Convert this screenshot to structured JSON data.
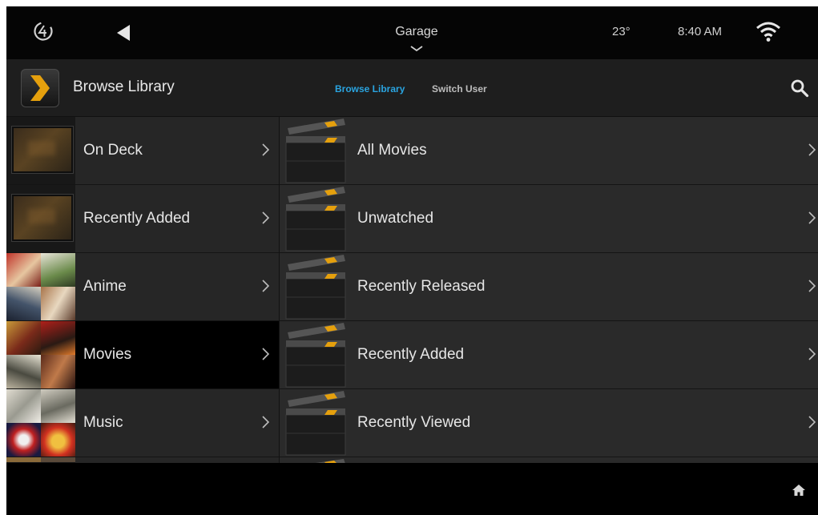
{
  "status_bar": {
    "room": "Garage",
    "temperature": "23°",
    "time": "8:40 AM"
  },
  "icons": {
    "logo": "control4-logo-icon",
    "back": "back-triangle-icon",
    "room_dropdown": "chevron-down-icon",
    "wifi": "wifi-icon",
    "app": "plex-chevron-icon",
    "search": "search-icon",
    "row_chevron": "chevron-right-icon",
    "home": "home-icon"
  },
  "header": {
    "title": "Browse Library",
    "tabs": [
      {
        "label": "Browse Library",
        "active": true
      },
      {
        "label": "Switch User",
        "active": false
      }
    ]
  },
  "colors": {
    "accent": "#2aa4e0",
    "plex_orange": "#e5a00d"
  },
  "left_list": [
    {
      "label": "On Deck",
      "thumb": "tv-icon",
      "selected": false
    },
    {
      "label": "Recently Added",
      "thumb": "tv-icon",
      "selected": false
    },
    {
      "label": "Anime",
      "thumb": "poster-mosaic",
      "selected": false
    },
    {
      "label": "Movies",
      "thumb": "poster-mosaic",
      "selected": true
    },
    {
      "label": "Music",
      "thumb": "poster-mosaic",
      "selected": false
    }
  ],
  "right_list": [
    {
      "label": "All Movies",
      "thumb": "clapperboard-icon"
    },
    {
      "label": "Unwatched",
      "thumb": "clapperboard-icon"
    },
    {
      "label": "Recently Released",
      "thumb": "clapperboard-icon"
    },
    {
      "label": "Recently Added",
      "thumb": "clapperboard-icon"
    },
    {
      "label": "Recently Viewed",
      "thumb": "clapperboard-icon"
    }
  ]
}
